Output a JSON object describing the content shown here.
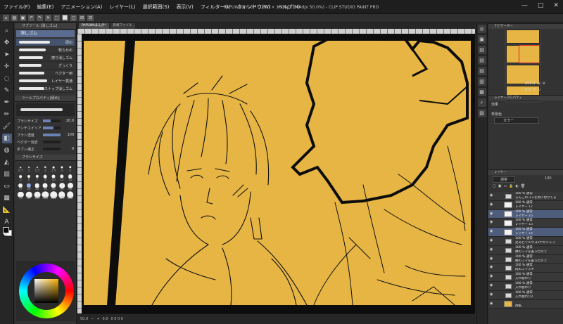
{
  "app": {
    "title": "PAPUWAまんが* (1200 × 1600px 144dpi 50.0%) - CLIP STUDIO PAINT PRO",
    "menu": [
      "ファイル(F)",
      "編集(E)",
      "アニメーション(A)",
      "レイヤー(L)",
      "選択範囲(S)",
      "表示(V)",
      "フィルター(I)",
      "ウィンドウ(W)",
      "ヘルプ(H)"
    ],
    "window_controls": [
      "—",
      "□",
      "✕"
    ]
  },
  "left_panel": {
    "subtool_header": "サブツール [消しゴム]",
    "subtool_selected": "消しゴム",
    "brushes": [
      {
        "name": "硬め",
        "selected": true,
        "width": 44
      },
      {
        "name": "軟らかめ",
        "selected": false,
        "width": 38
      },
      {
        "name": "擦り消しゴム",
        "selected": false,
        "width": 34
      },
      {
        "name": "ざっくり",
        "selected": false,
        "width": 32
      },
      {
        "name": "ベクター用",
        "selected": false,
        "width": 36
      },
      {
        "name": "レイヤー貫通",
        "selected": false,
        "width": 40
      },
      {
        "name": "スナップ消しゴム",
        "selected": false,
        "width": 36
      }
    ],
    "tool_property_header": "ツールプロパティ[硬め]",
    "properties": [
      {
        "label": "ブラシサイズ",
        "value": "20.0",
        "fill": 0.45
      },
      {
        "label": "アンチエイリアス",
        "value": "",
        "fill": 0.6
      },
      {
        "label": "ブラシ濃度",
        "value": "100",
        "fill": 1.0
      },
      {
        "label": "ベクター消去",
        "value": "",
        "fill": 0.0
      },
      {
        "label": "手ブレ補正",
        "value": "0",
        "fill": 0.0
      }
    ],
    "brush_size_header": "ブラシサイズ",
    "brush_sizes": [
      "0.7",
      "1",
      "1.5",
      "2",
      "2.5",
      "3",
      "4",
      "5",
      "6",
      "7",
      "8",
      "10",
      "12",
      "15",
      "17",
      "20",
      "25",
      "30",
      "40",
      "50",
      "60",
      "70",
      "80",
      "100",
      "120",
      "150",
      "170",
      "200"
    ]
  },
  "tabs": [
    "PAPUWAまんが*",
    "新規ファイル"
  ],
  "status": {
    "zoom": "50.0",
    "angle": "0.0",
    "coords": "0 0 0 0"
  },
  "right_panel": {
    "navigator_header": "ナビゲーター",
    "zoom_value": "200.0",
    "rotate_value": "0.0",
    "layer_prop_header": "レイヤープロパティ",
    "effect_label": "効果",
    "color_label": "表現色",
    "color_value": "カラー",
    "layer_header": "レイヤー",
    "blend_mode": "通常",
    "opacity": "100",
    "layers": [
      {
        "type": "folder",
        "line1": "100 % 通常",
        "line2": "らんこのコマを用に付けてる",
        "selected": false,
        "eye": true
      },
      {
        "type": "layer",
        "line1": "100 % 通常",
        "line2": "レイヤー 17",
        "selected": false,
        "eye": true
      },
      {
        "type": "layer",
        "line1": "100 % 通常",
        "line2": "レイヤー 16",
        "selected": true,
        "eye": true
      },
      {
        "type": "layer",
        "line1": "100 % 通常",
        "line2": "レイヤー 15",
        "selected": false,
        "eye": true
      },
      {
        "type": "layer",
        "line1": "100 % 通常",
        "line2": "レイヤー 14",
        "selected": true,
        "eye": true
      },
      {
        "type": "folder",
        "line1": "100 % 通常",
        "line2": "足あとワルウヨ3ナのシャマ",
        "selected": false,
        "eye": true
      },
      {
        "type": "folder",
        "line1": "100 % 通常",
        "line2": "隣のコマを置ったので",
        "selected": false,
        "eye": true
      },
      {
        "type": "folder",
        "line1": "100 % 通常",
        "line2": "隣のコマを置ったので",
        "selected": false,
        "eye": true
      },
      {
        "type": "folder",
        "line1": "100 % 通常",
        "line2": "肉のコマズキ",
        "selected": false,
        "eye": true
      },
      {
        "type": "folder",
        "line1": "100 % 通常",
        "line2": "入れ替わり",
        "selected": false,
        "eye": true
      },
      {
        "type": "folder",
        "line1": "100 % 通常",
        "line2": "入れ替わり",
        "selected": false,
        "eye": true
      },
      {
        "type": "folder",
        "line1": "100 % 通常",
        "line2": "入れ替わり2",
        "selected": false,
        "eye": true
      },
      {
        "type": "fill",
        "line1": "",
        "line2": "用紙",
        "selected": false,
        "eye": true
      }
    ]
  },
  "colors": {
    "canvas_yellow": "#e6b544",
    "ink": "#0d0d0d",
    "selection_blue": "#4f5d7c",
    "foreground": "#0b0b0b",
    "background": "#ffffff"
  }
}
